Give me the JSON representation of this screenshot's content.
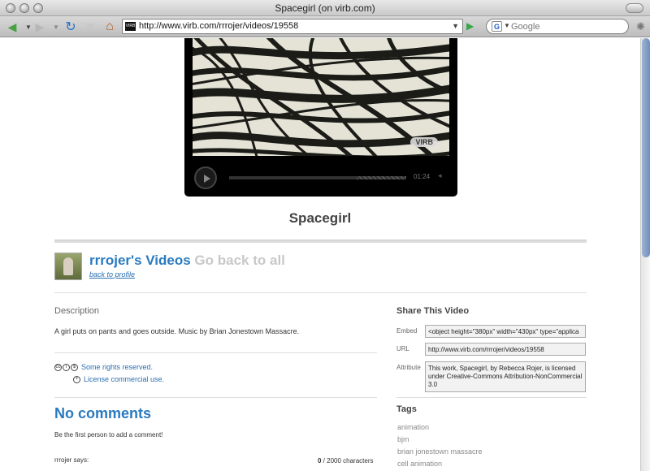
{
  "window": {
    "title": "Spacegirl (on virb.com)"
  },
  "toolbar": {
    "url": "http://www.virb.com/rrrojer/videos/19558",
    "search_placeholder": "Google",
    "favicon_text": "VIRB"
  },
  "player": {
    "badge": "VIRB",
    "time": "01:24",
    "progress_fraction": 0.72
  },
  "video": {
    "title": "Spacegirl"
  },
  "user": {
    "owner_heading": "rrrojer's Videos",
    "back_all": "Go back to all",
    "back_profile": "back to profile"
  },
  "description": {
    "label": "Description",
    "text": "A girl puts on pants and goes outside. Music by Brian Jonestown Massacre."
  },
  "license": {
    "rights": "Some rights reserved.",
    "commercial": "License commercial use.",
    "icons": [
      "cc-icon",
      "by-icon",
      "nc-icon"
    ]
  },
  "comments": {
    "heading": "No comments",
    "prompt": "Be the first person to add a comment!",
    "says": "rrrojer says:",
    "count_current": "0",
    "count_suffix": " / 2000 characters"
  },
  "share": {
    "heading": "Share This Video",
    "embed_label": "Embed",
    "embed_value": "<object height=\"380px\" width=\"430px\" type=\"applica",
    "url_label": "URL",
    "url_value": "http://www.virb.com/rrrojer/videos/19558",
    "attribute_label": "Attribute",
    "attribute_value": "This work, Spacegirl, by Rebecca Rojer, is licensed under Creative-Commons Attribution-NonCommercial 3.0"
  },
  "tags": {
    "heading": "Tags",
    "items": [
      "animation",
      "bjm",
      "brian jonestown massacre",
      "cell animation"
    ]
  }
}
